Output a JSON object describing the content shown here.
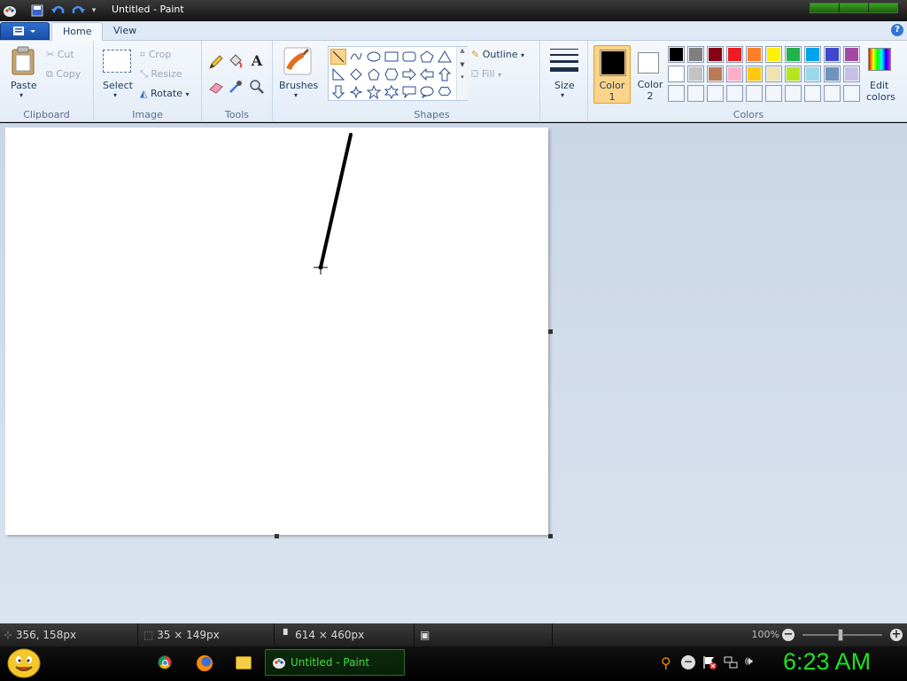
{
  "window": {
    "title": "Untitled - Paint"
  },
  "tabs": [
    {
      "label": "Home"
    },
    {
      "label": "View"
    }
  ],
  "ribbon": {
    "clipboard": {
      "group": "Clipboard",
      "paste": "Paste",
      "cut": "Cut",
      "copy": "Copy"
    },
    "image": {
      "group": "Image",
      "select": "Select",
      "crop": "Crop",
      "resize": "Resize",
      "rotate": "Rotate"
    },
    "tools": {
      "group": "Tools"
    },
    "brushes": {
      "label": "Brushes"
    },
    "shapes": {
      "group": "Shapes",
      "outline": "Outline",
      "fill": "Fill"
    },
    "size": {
      "label": "Size"
    },
    "colors": {
      "group": "Colors",
      "color1_line1": "Color",
      "color1_line2": "1",
      "color2_line1": "Color",
      "color2_line2": "2",
      "edit_line1": "Edit",
      "edit_line2": "colors",
      "color1": "#000000",
      "color2": "#ffffff",
      "palette_row1": [
        "#000000",
        "#7f7f7f",
        "#880015",
        "#ed1c24",
        "#ff7f27",
        "#fff200",
        "#22b14c",
        "#00a2e8",
        "#3f48cc",
        "#a349a4"
      ],
      "palette_row2": [
        "#ffffff",
        "#c3c3c3",
        "#b97a57",
        "#ffaec9",
        "#ffc90e",
        "#efe4b0",
        "#b5e61d",
        "#99d9ea",
        "#7092be",
        "#c8bfe7"
      ]
    }
  },
  "status": {
    "cursor_pos": "356, 158px",
    "selection_size": "35 × 149px",
    "image_size": "614 × 460px",
    "zoom": "100%"
  },
  "taskbar": {
    "active_app": "Untitled - Paint",
    "clock": "6:23 AM"
  }
}
